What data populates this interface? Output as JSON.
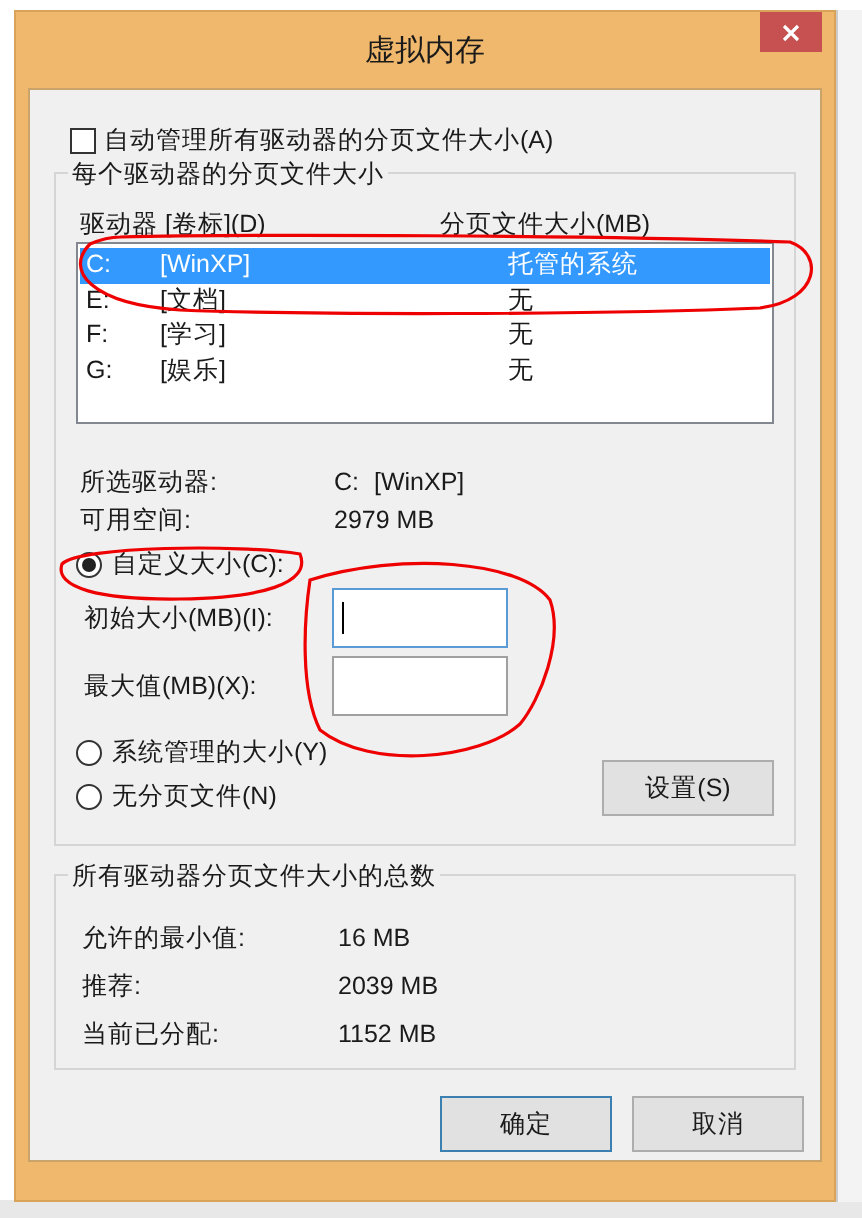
{
  "window": {
    "title": "虚拟内存"
  },
  "auto_manage": {
    "label": "自动管理所有驱动器的分页文件大小(A)",
    "checked": false
  },
  "per_drive": {
    "title": "每个驱动器的分页文件大小",
    "columns": [
      "驱动器 [卷标](D)",
      "分页文件大小(MB)"
    ],
    "rows": [
      {
        "drive": "C:",
        "volume": "[WinXP]",
        "size": "托管的系统",
        "selected": true
      },
      {
        "drive": "E:",
        "volume": "[文档]",
        "size": "无",
        "selected": false
      },
      {
        "drive": "F:",
        "volume": "[学习]",
        "size": "无",
        "selected": false
      },
      {
        "drive": "G:",
        "volume": "[娱乐]",
        "size": "无",
        "selected": false
      }
    ],
    "selected_drive": {
      "label": "所选驱动器:",
      "drive": "C:",
      "volume": "[WinXP]"
    },
    "free_space": {
      "label": "可用空间:",
      "value": "2979 MB"
    },
    "size_options": [
      {
        "label": "自定义大小(C):",
        "selected": true
      },
      {
        "label": "系统管理的大小(Y)",
        "selected": false
      },
      {
        "label": "无分页文件(N)",
        "selected": false
      }
    ],
    "fields": [
      {
        "label": "初始大小(MB)(I):",
        "focused": true
      },
      {
        "label": "最大值(MB)(X):",
        "focused": false
      }
    ],
    "set_button": "设置(S)"
  },
  "totals": {
    "title": "所有驱动器分页文件大小的总数",
    "rows": [
      {
        "label": "允许的最小值:",
        "value": "16 MB"
      },
      {
        "label": "推荐:",
        "value": "2039 MB"
      },
      {
        "label": "当前已分配:",
        "value": "1152 MB"
      }
    ]
  },
  "buttons": [
    {
      "label": "确定",
      "default": true
    },
    {
      "label": "取消",
      "default": false
    }
  ]
}
